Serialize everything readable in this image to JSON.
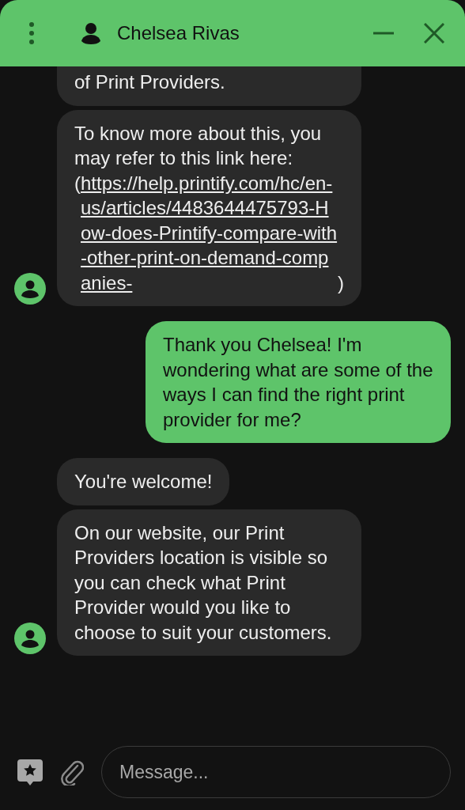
{
  "header": {
    "title": "Chelsea Rivas"
  },
  "groups": [
    {
      "kind": "incoming",
      "bubbles": [
        {
          "kind": "clipped",
          "text": "of Print Providers."
        },
        {
          "kind": "with-link",
          "text": "To know more about this, you may refer to this link here:",
          "link": {
            "open": "(",
            "url": "https://help.printify.com/hc/en-us/articles/4483644475793-How-does-Printify-compare-with-other-print-on-demand-companies-",
            "close": ")"
          }
        }
      ]
    },
    {
      "kind": "outgoing",
      "bubbles": [
        {
          "kind": "plain",
          "text": "Thank you Chelsea! I'm wondering what are some of the ways I can find the right print provider for me?"
        }
      ]
    },
    {
      "kind": "incoming",
      "bubbles": [
        {
          "kind": "plain",
          "text": "You're welcome!"
        },
        {
          "kind": "plain",
          "text": "On our website, our Print Providers location is visible so you can check what Print Provider would you like to choose to suit your customers."
        }
      ]
    }
  ],
  "composer": {
    "placeholder": "Message..."
  }
}
